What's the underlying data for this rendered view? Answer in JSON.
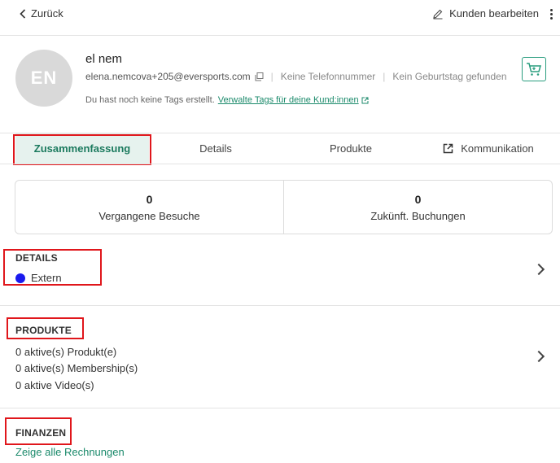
{
  "topbar": {
    "back_label": "Zurück",
    "edit_label": "Kunden bearbeiten"
  },
  "profile": {
    "initials": "EN",
    "name": "el nem",
    "email": "elena.nemcova+205@eversports.com",
    "phone": "Keine Telefonnummer",
    "birthday": "Kein Geburtstag gefunden",
    "tags_text": "Du hast noch keine Tags erstellt.",
    "tags_link": "Verwalte Tags für deine Kund:innen"
  },
  "tabs": [
    {
      "label": "Zusammenfassung",
      "active": true
    },
    {
      "label": "Details",
      "active": false
    },
    {
      "label": "Produkte",
      "active": false
    },
    {
      "label": "Kommunikation",
      "active": false
    }
  ],
  "stats": [
    {
      "value": "0",
      "label": "Vergangene Besuche"
    },
    {
      "value": "0",
      "label": "Zukünft. Buchungen"
    }
  ],
  "details": {
    "title": "DETAILS",
    "status_label": "Extern",
    "status_color": "#1a1aee"
  },
  "products": {
    "title": "PRODUKTE",
    "lines": [
      "0 aktive(s) Produkt(e)",
      "0 aktive(s) Membership(s)",
      "0 aktive Video(s)"
    ]
  },
  "finances": {
    "title": "FINANZEN",
    "link": "Zeige alle Rechnungen"
  },
  "colors": {
    "accent": "#1b8a6b",
    "highlight_box": "#e0161b",
    "active_tab_bg": "#e6f2ee"
  }
}
